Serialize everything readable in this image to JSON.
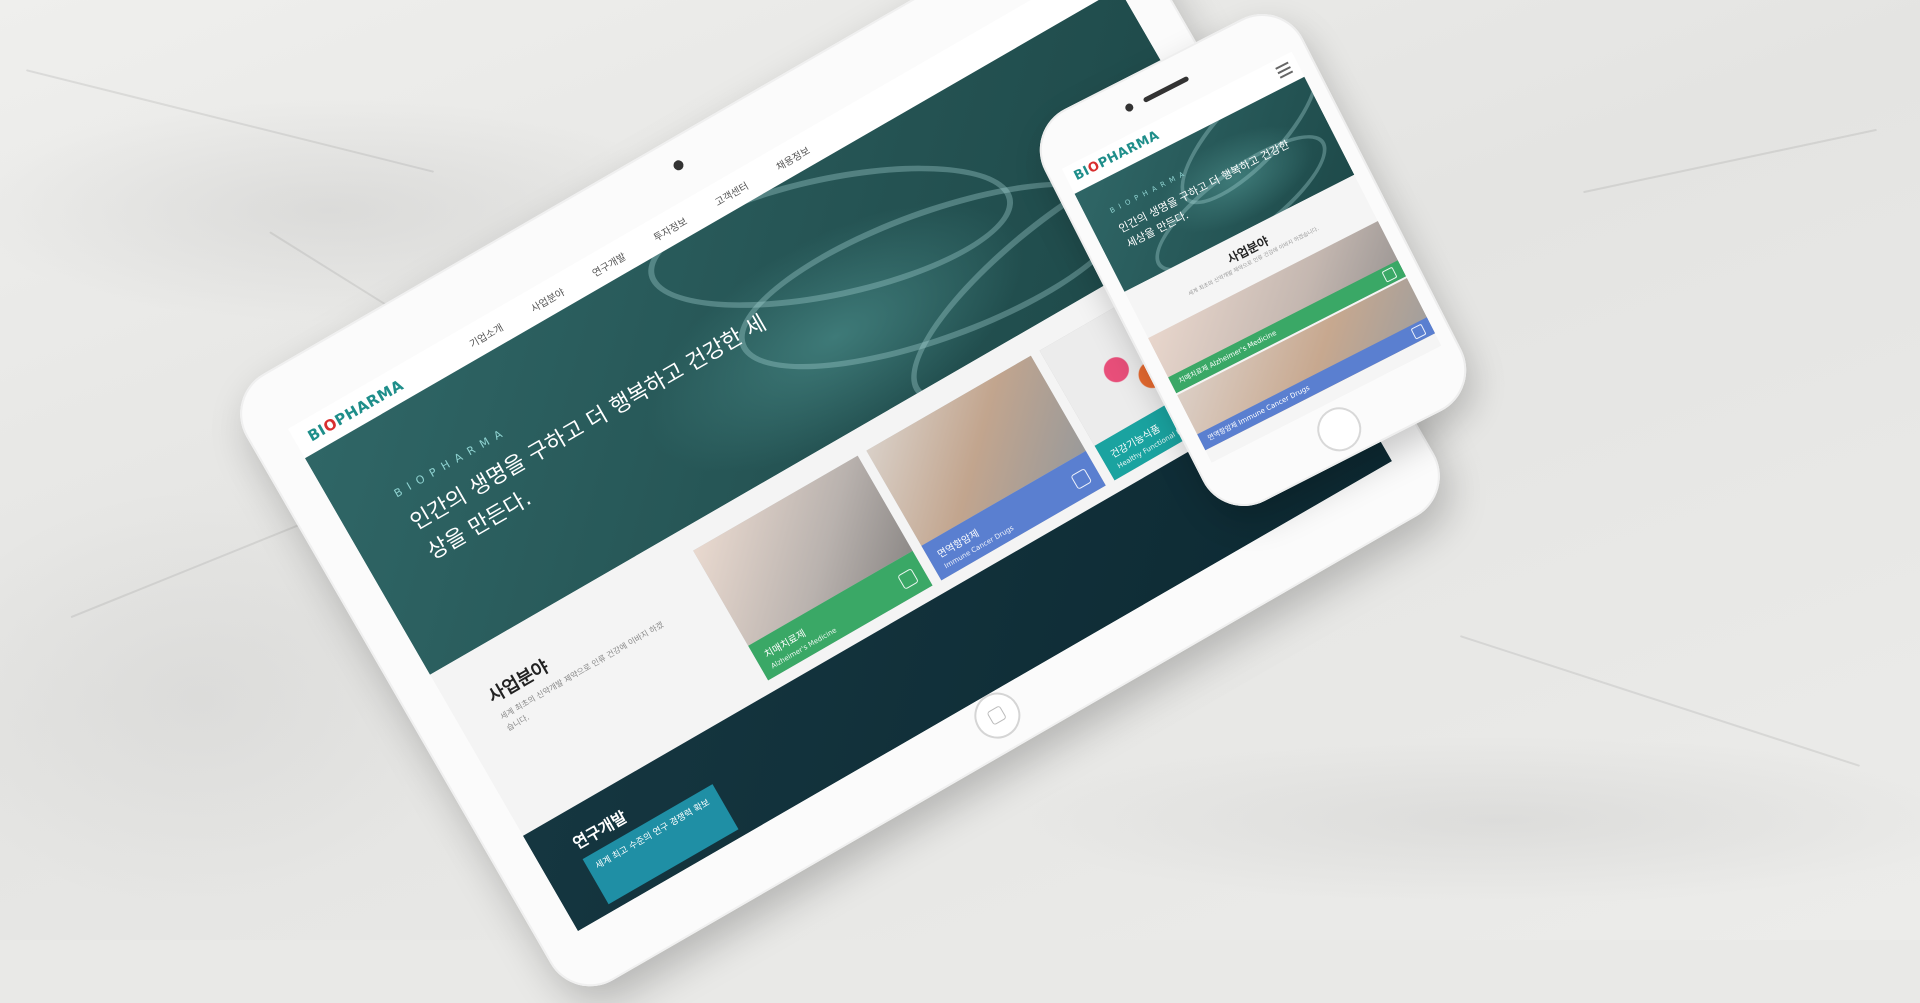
{
  "brand": {
    "logo_prefix": "BI",
    "logo_o": "O",
    "logo_suffix": "PHARMA",
    "tagline": "BIOPHARMA",
    "accent_color": "#1e8e8a",
    "logo_dot_color": "#d82f2f"
  },
  "hero": {
    "slogan": "인간의 생명을 구하고 더 행복하고 건강한 세상을 만든다."
  },
  "tablet": {
    "nav": [
      "기업소개",
      "사업분야",
      "연구개발",
      "투자정보",
      "고객센터",
      "채용정보"
    ],
    "business": {
      "title": "사업분야",
      "description": "세계 최초의 신약개발 제약으로 인류 건강에 이바지 하겠습니다."
    },
    "cards": [
      {
        "title": "치매치료제",
        "subtitle": "Alzheimer's Medicine",
        "color": "#3aa866"
      },
      {
        "title": "면역항암제",
        "subtitle": "Immune Cancer Drugs",
        "color": "#5a7fd0"
      },
      {
        "title": "건강기능식품",
        "subtitle": "Healthy Functional Foods",
        "color": "#1aa3a0"
      }
    ],
    "research": {
      "title": "연구개발",
      "box_text": "세계 최고 수준의 연구 경쟁력 확보"
    }
  },
  "phone": {
    "business": {
      "title": "사업분야",
      "description": "세계 최초의 신약개발 제약으로 인류 건강에 이바지 하겠습니다."
    },
    "rows": [
      {
        "title": "치매치료제",
        "subtitle": "Alzheimer's Medicine",
        "color": "#3aa866"
      },
      {
        "title": "면역항암제",
        "subtitle": "Immune Cancer Drugs",
        "color": "#5a7fd0"
      }
    ]
  }
}
